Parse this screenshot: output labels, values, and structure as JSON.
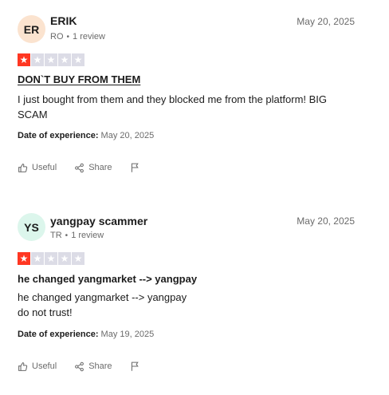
{
  "reviews": [
    {
      "initials": "ER",
      "name": "ERIK",
      "country": "RO",
      "review_count": "1 review",
      "date": "May 20, 2025",
      "rating": 1,
      "title": "DON`T BUY FROM THEM",
      "body": "I just bought from them and they blocked me from the platform! BIG SCAM",
      "experience_label": "Date of experience:",
      "experience_date": "May 20, 2025",
      "useful_label": "Useful",
      "share_label": "Share"
    },
    {
      "initials": "YS",
      "name": "yangpay scammer",
      "country": "TR",
      "review_count": "1 review",
      "date": "May 20, 2025",
      "rating": 1,
      "title": "he changed yangmarket --> yangpay",
      "body_line1": "he changed yangmarket --> yangpay",
      "body_line2": "do not trust!",
      "experience_label": "Date of experience:",
      "experience_date": "May 19, 2025",
      "useful_label": "Useful",
      "share_label": "Share"
    }
  ],
  "colors": {
    "star_on": "#ff3722",
    "star_off": "#dcdce6",
    "avatar_1": "#fbe3cf",
    "avatar_2": "#dcf6ec"
  }
}
